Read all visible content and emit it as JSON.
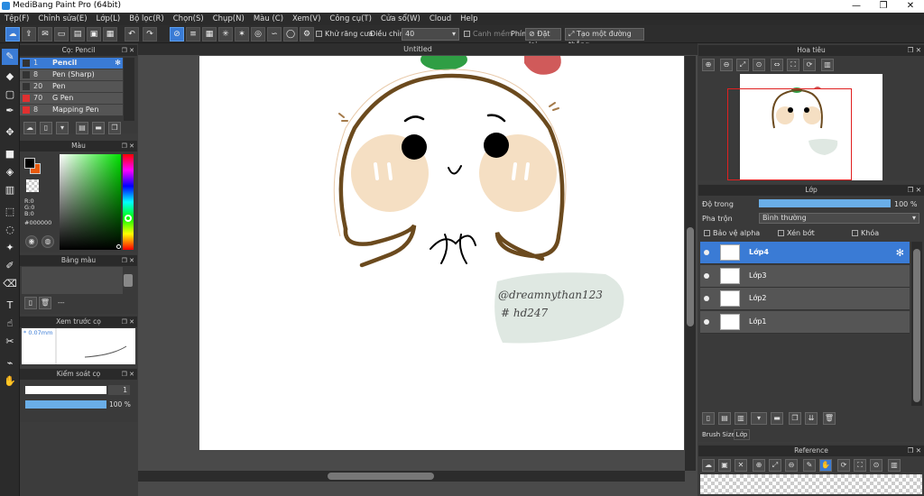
{
  "window": {
    "title": "MediBang Paint Pro (64bit)",
    "minimize": "—",
    "maximize": "❐",
    "close": "✕"
  },
  "menu": [
    "Tệp(F)",
    "Chỉnh sửa(E)",
    "Lớp(L)",
    "Bộ lọc(R)",
    "Chọn(S)",
    "Chụp(N)",
    "Màu (C)",
    "Xem(V)",
    "Công cụ(T)",
    "Cửa sổ(W)",
    "Cloud",
    "Help"
  ],
  "toolbar": {
    "antialias_label": "Khử răng cưa",
    "adjust_label": "Điều chỉnh",
    "adjust_value": "40",
    "smooth_label": "Canh mềm",
    "key_label": "Phím",
    "reset_label": "Đặt lại",
    "straight_label": "Tạo một đường thẳng"
  },
  "brush_panel": {
    "title": "Cọ: Pencil",
    "brushes": [
      {
        "size": "1",
        "name": "Pencil",
        "color": "#333333",
        "selected": true
      },
      {
        "size": "8",
        "name": "Pen (Sharp)",
        "color": "#333333",
        "selected": false
      },
      {
        "size": "20",
        "name": "Pen",
        "color": "#333333",
        "selected": false
      },
      {
        "size": "70",
        "name": "G Pen",
        "color": "#e03030",
        "selected": false
      },
      {
        "size": "8",
        "name": "Mapping Pen",
        "color": "#e03030",
        "selected": false
      }
    ]
  },
  "color_panel": {
    "title": "Màu",
    "r": "R:0",
    "g": "G:0",
    "b": "B:0",
    "hex": "#000000",
    "fg": "#000000",
    "bg": "#e8590c"
  },
  "palette_panel": {
    "title": "Bảng màu",
    "dashes": "---"
  },
  "preview_panel": {
    "title": "Xem trước cọ",
    "size": "* 0.07mm"
  },
  "control_panel": {
    "title": "Kiểm soát cọ",
    "size": "1",
    "opacity": "100 %"
  },
  "document": {
    "title": "Untitled",
    "watermark_line1": "@dreamnythan123",
    "watermark_line2": "# hd247"
  },
  "navigator": {
    "title": "Hoa tiêu"
  },
  "layer_panel": {
    "title": "Lớp",
    "opacity_label": "Độ trong",
    "opacity_value": "100 %",
    "opacity": 1.0,
    "blend_label": "Pha trộn",
    "blend_value": "Bình thường",
    "protect_alpha": "Bảo vệ alpha",
    "clip": "Xén bớt",
    "lock": "Khóa",
    "layers": [
      {
        "name": "Lớp4",
        "selected": true
      },
      {
        "name": "Lớp3",
        "selected": false
      },
      {
        "name": "Lớp2",
        "selected": false
      },
      {
        "name": "Lớp1",
        "selected": false
      }
    ],
    "tab_brush_size": "Brush Size",
    "tab_layer": "Lớp"
  },
  "reference_panel": {
    "title": "Reference"
  }
}
